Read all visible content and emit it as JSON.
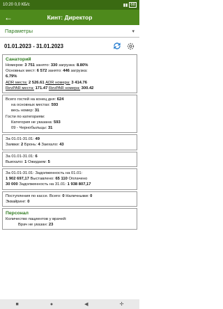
{
  "status": {
    "time": "10:20",
    "speed": "0,0 КБ/с",
    "battery": "68"
  },
  "app": {
    "title": "Кинт: Директор"
  },
  "params": {
    "label": "Параметры"
  },
  "period": {
    "dates": "01.01.2023 - 31.01.2023"
  },
  "sanatorium": {
    "title": "Санаторий",
    "rooms_label": "Номеров:",
    "rooms": "3 751",
    "occupied_label": "занято:",
    "occupied": "330",
    "load_label": "загрузка:",
    "load": "8.80%",
    "main_places_label": "Основных мест:",
    "main_places": "6 572",
    "main_occupied_label": "занято:",
    "main_occupied": "446",
    "main_load_label": "загрузка:",
    "main_load": "6.79%",
    "adr_places_label": "ADR места:",
    "adr_places": "2 526.61",
    "adr_rooms_label": "ADR номера:",
    "adr_rooms": "3 414.76",
    "revpar_places_label": "RevPAR места:",
    "revpar_places": "171.47",
    "revpar_rooms_label": "RevPAR номера:",
    "revpar_rooms": "300.42"
  },
  "guests": {
    "total_label": "Всего гостей на конец дня:",
    "total": "624",
    "main_label": "на основных местах:",
    "main": "593",
    "whole_label": "весь номер:",
    "whole": "31",
    "cat_title": "Гости по категориям:",
    "cat1_label": "Категория не указана:",
    "cat1": "593",
    "cat2_label": "09 - Чернобыльцы:",
    "cat2": "31"
  },
  "bookings": {
    "period_label": "За 01.01-31.01:",
    "period_value": "49",
    "requests_label": "Заявки:",
    "requests": "2",
    "booking_label": "Бронь:",
    "booking": "4",
    "checked_in_label": "Заехало:",
    "checked_in": "43"
  },
  "departures": {
    "period_label": "За 01.01-31.01:",
    "period_value": "6",
    "left_label": "Выехало:",
    "left": "1",
    "expected_label": "Ожидаем:",
    "expected": "5"
  },
  "debt": {
    "line1_label": "За 01.01-31.01: Задолженность на 01.01:",
    "debt_start": "1 902 697,17",
    "issued_label": "Выставлено:",
    "issued": "65 110",
    "paid_label": "Оплачено",
    "paid": "30 000",
    "end_label": "Задолженность на 31.01:",
    "debt_end": "1 938 807,17"
  },
  "cash": {
    "line1": "Поступления по кассе. Всего:",
    "total": "0",
    "cash_label": "Наличными:",
    "cash": "0",
    "acquiring_label": "Эквайринг:",
    "acquiring": "0"
  },
  "staff": {
    "title": "Персонал",
    "patients_label": "Количество пациентов у врачей:",
    "doctor_label": "Врач не указан:",
    "doctor_value": "23"
  }
}
